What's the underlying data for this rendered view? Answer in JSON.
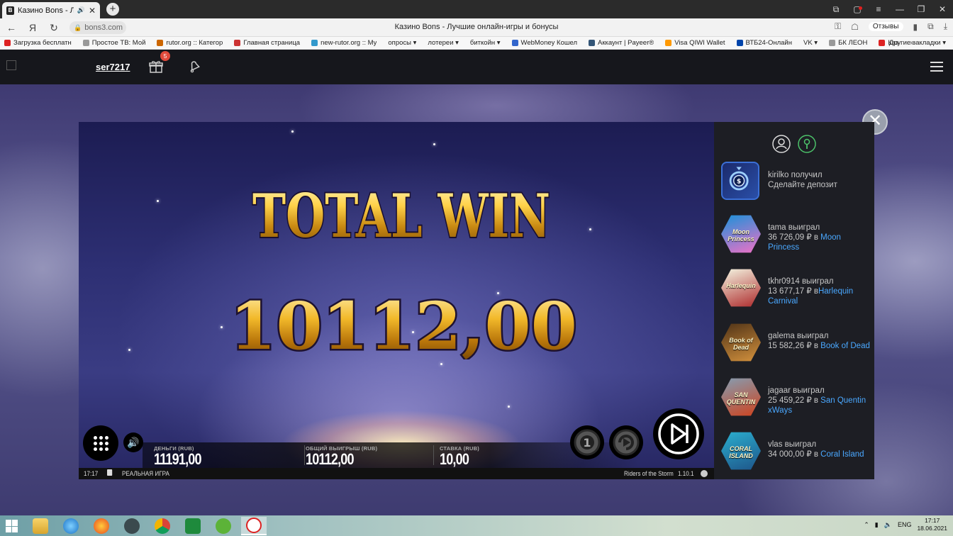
{
  "browser": {
    "tab_title": "Казино Bons - Лучши",
    "tab_close": "✕",
    "new_tab": "+",
    "url": "bons3.com",
    "page_title": "Казино Bons - Лучшие онлайн-игры и бонусы",
    "reviews_label": "Отзывы",
    "win_minimize": "—",
    "win_maximize": "❐",
    "win_close": "✕"
  },
  "bookmarks": [
    {
      "label": "Загрузка бесплатн",
      "color": "#d22"
    },
    {
      "label": "Простое ТВ: Мой",
      "color": "#999"
    },
    {
      "label": "rutor.org :: Категор",
      "color": "#c60"
    },
    {
      "label": "Главная страница",
      "color": "#c33"
    },
    {
      "label": "new-rutor.org :: Му",
      "color": "#39c"
    },
    {
      "label": "опросы ▾",
      "color": ""
    },
    {
      "label": "лотереи ▾",
      "color": ""
    },
    {
      "label": "биткойн ▾",
      "color": ""
    },
    {
      "label": "WebMoney Кошел",
      "color": "#36c"
    },
    {
      "label": "Аккаунт | Payeer®",
      "color": "#357"
    },
    {
      "label": "Visa QIWI Wallet",
      "color": "#f90"
    },
    {
      "label": "ВТБ24-Онлайн",
      "color": "#04a"
    },
    {
      "label": "VK ▾",
      "color": ""
    },
    {
      "label": "БК ЛЕОН",
      "color": "#999"
    },
    {
      "label": "Каз",
      "color": "#d22"
    }
  ],
  "bookmarks_more": "»",
  "bookmarks_other": "Другие закладки ▾",
  "site": {
    "username": "ser7217",
    "gift_badge": "5"
  },
  "close_overlay": "✕",
  "game": {
    "banner": "TOTAL WIN",
    "win_amount": "10112,00",
    "balance_label": "ДЕНЬГИ (RUB)",
    "balance_value": "11191,00",
    "total_win_label": "ОБЩИЙ ВЫИГРЫШ (RUB)",
    "total_win_value": "10112,00",
    "bet_label": "СТАВКА (RUB)",
    "bet_value": "10,00",
    "clock": "17:17",
    "mode": "РЕАЛЬНАЯ ИГРА",
    "game_name": "Riders of the Storm",
    "version": "1.10.1"
  },
  "feed": [
    {
      "user_line": "kirilko получил",
      "amount_line": "Сделайте депозит",
      "game": "",
      "thumb": "deposit",
      "colors": [
        "#1b2a6b",
        "#2a4fa8"
      ]
    },
    {
      "user_line": "tama выиграл",
      "amount_line": "36 726,09 ₽ в ",
      "game": "Moon Princess",
      "thumb": "Moon Princess",
      "colors": [
        "#2b8fd8",
        "#e073c8"
      ]
    },
    {
      "user_line": "tkhr0914 выиграл",
      "amount_line": "13 677,17 ₽ в",
      "game": "Harlequin Carnival",
      "thumb": "Harlequin",
      "colors": [
        "#efe6d4",
        "#b33a3a"
      ]
    },
    {
      "user_line": "galema выиграл",
      "amount_line": "15 582,26 ₽ в ",
      "game": "Book of Dead",
      "thumb": "Book of Dead",
      "colors": [
        "#5a3a1a",
        "#c98a3a"
      ]
    },
    {
      "user_line": "jagaar выиграл",
      "amount_line": "25 459,22 ₽ в ",
      "game": "San Quentin xWays",
      "thumb": "SAN QUENTIN",
      "colors": [
        "#8b96a6",
        "#c84a2a"
      ]
    },
    {
      "user_line": "vlas выиграл",
      "amount_line": "34 000,00 ₽ в ",
      "game": "Coral Island",
      "thumb": "CORAL ISLAND",
      "colors": [
        "#2aa7c9",
        "#1f5c8f"
      ]
    }
  ],
  "taskbar": {
    "lang": "ENG",
    "time": "17:17",
    "date": "18.06.2021"
  }
}
